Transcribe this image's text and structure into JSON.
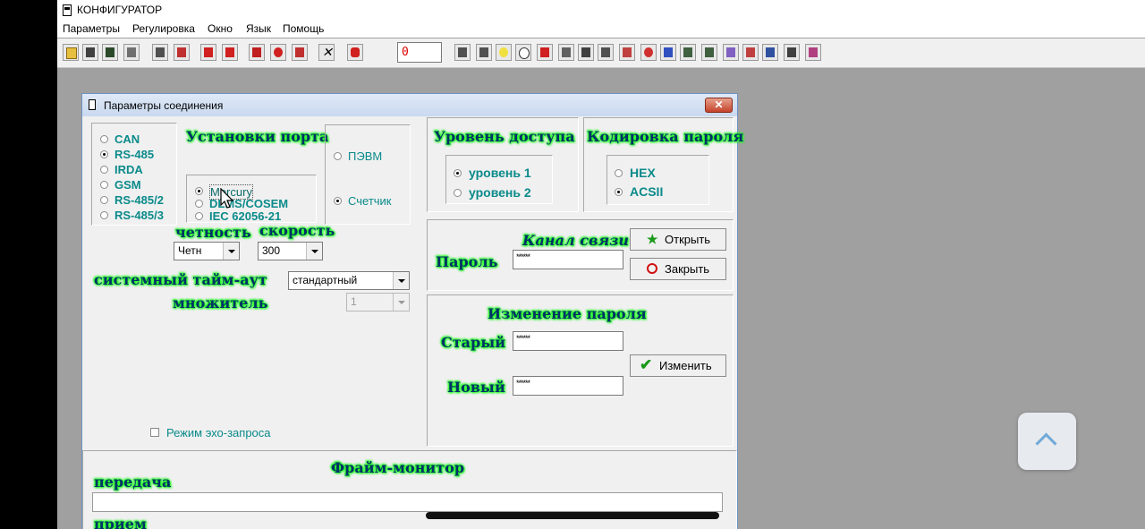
{
  "window": {
    "title": "КОНФИГУРАТОР"
  },
  "menu": [
    "Параметры",
    "Регулировка",
    "Окно",
    "Язык",
    "Помощь"
  ],
  "toolbar": {
    "counter_value": "0"
  },
  "dialog": {
    "title": "Параметры соединения",
    "close_label": "✕",
    "interface_options": [
      {
        "label": "CAN",
        "selected": false
      },
      {
        "label": "RS-485",
        "selected": true
      },
      {
        "label": "IRDA",
        "selected": false
      },
      {
        "label": "GSM",
        "selected": false
      },
      {
        "label": "RS-485/2",
        "selected": false
      },
      {
        "label": "RS-485/3",
        "selected": false
      }
    ],
    "port_settings_title": "Установки порта",
    "protocol_options": [
      {
        "label": "Mercury",
        "selected": true
      },
      {
        "label": "DLMS/COSEM",
        "selected": false
      },
      {
        "label": "IEC 62056-21",
        "selected": false
      }
    ],
    "device_options": [
      {
        "label": "ПЭВМ",
        "selected": false
      },
      {
        "label": "Счетчик",
        "selected": true
      }
    ],
    "parity_label": "четность",
    "parity_value": "Четн",
    "speed_label": "скорость",
    "speed_value": "300",
    "timeout_label": "системный тайм-аут",
    "timeout_value": "стандартный",
    "multiplier_label": "множитель",
    "multiplier_value": "1",
    "access_title": "Уровень доступа",
    "access_options": [
      {
        "label": "уровень 1",
        "selected": true
      },
      {
        "label": "уровень 2",
        "selected": false
      }
    ],
    "encoding_title": "Кодировка пароля",
    "encoding_options": [
      {
        "label": "HEX",
        "selected": false
      },
      {
        "label": "ACSII",
        "selected": true
      }
    ],
    "channel_title": "Канал связи",
    "password_label": "Пароль",
    "password_value": "******",
    "open_button": "Открыть",
    "close_button": "Закрыть",
    "change_title": "Изменение пароля",
    "old_label": "Старый",
    "old_value": "******",
    "new_label": "Новый",
    "new_value": "******",
    "change_button": "Изменить",
    "echo_label": "Режим эхо-запроса",
    "echo_checked": false,
    "monitor_title": "Фрайм-монитор",
    "tx_label": "передача",
    "rx_label": "прием"
  },
  "colors": {
    "glow": "#20ff20",
    "glow_text": "#003366",
    "radio_text": "#0b8a8a",
    "counter": "#dd0000"
  }
}
